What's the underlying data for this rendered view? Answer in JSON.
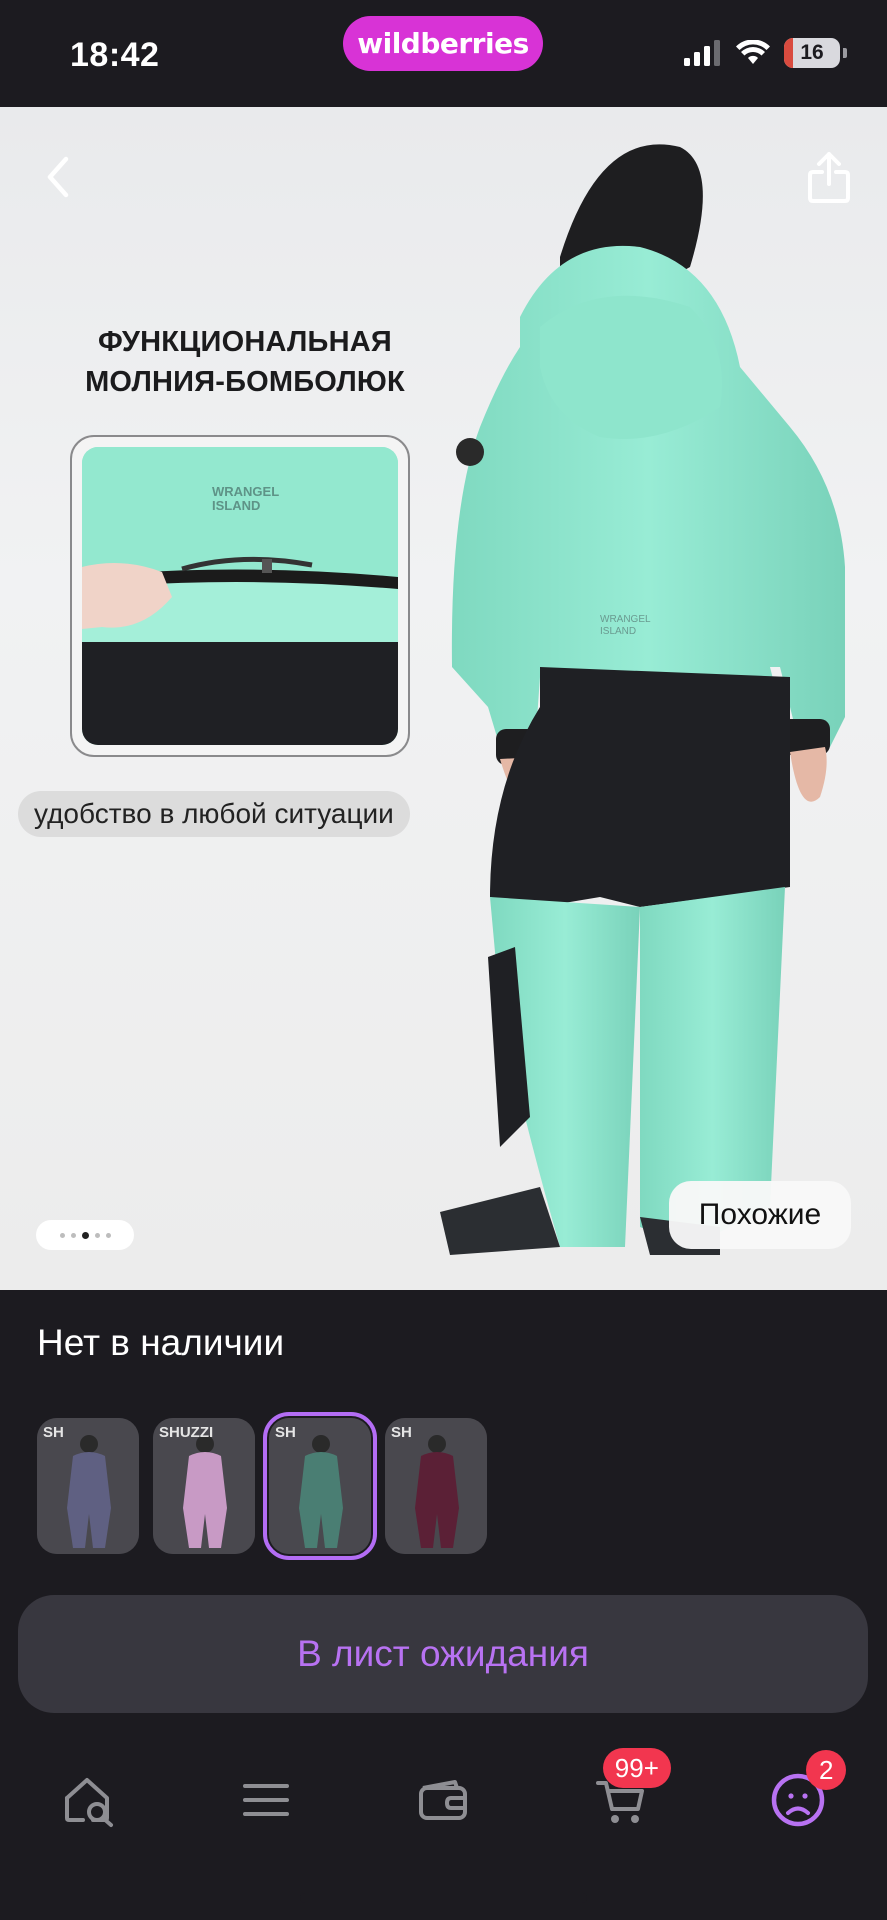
{
  "status_bar": {
    "time": "18:42",
    "brand_pill": "wildberries",
    "battery_level": "16",
    "battery_fraction": 0.16
  },
  "hero": {
    "headline_line1": "ФУНКЦИОНАЛЬНАЯ",
    "headline_line2": "МОЛНИЯ-БОМБОЛЮК",
    "detail_brand": "WRANGEL ISLAND",
    "caption": "удобство в любой ситуации",
    "similar_label": "Похожие",
    "gallery": {
      "count": 5,
      "active_index": 2
    },
    "icons": {
      "back": "chevron-left-icon",
      "share": "share-icon"
    }
  },
  "product": {
    "availability": "Нет в наличии",
    "variants": [
      {
        "brand": "SH",
        "color": "#5f6082"
      },
      {
        "brand": "SHUZZI",
        "color": "#c89ac5"
      },
      {
        "brand": "SH",
        "color": "#4a7e73"
      },
      {
        "brand": "SH",
        "color": "#5b2036"
      }
    ],
    "selected_variant_index": 2
  },
  "actions": {
    "wait_list_label": "В лист ожидания"
  },
  "tabbar": {
    "items": [
      {
        "icon": "home-search-icon"
      },
      {
        "icon": "menu-icon"
      },
      {
        "icon": "wallet-icon"
      },
      {
        "icon": "cart-icon",
        "badge": "99+"
      },
      {
        "icon": "profile-icon",
        "badge": "2"
      }
    ]
  },
  "colors": {
    "accent": "#b872f2",
    "brand": "#d833d6",
    "badge": "#f2364f",
    "background": "#1c1b20"
  }
}
